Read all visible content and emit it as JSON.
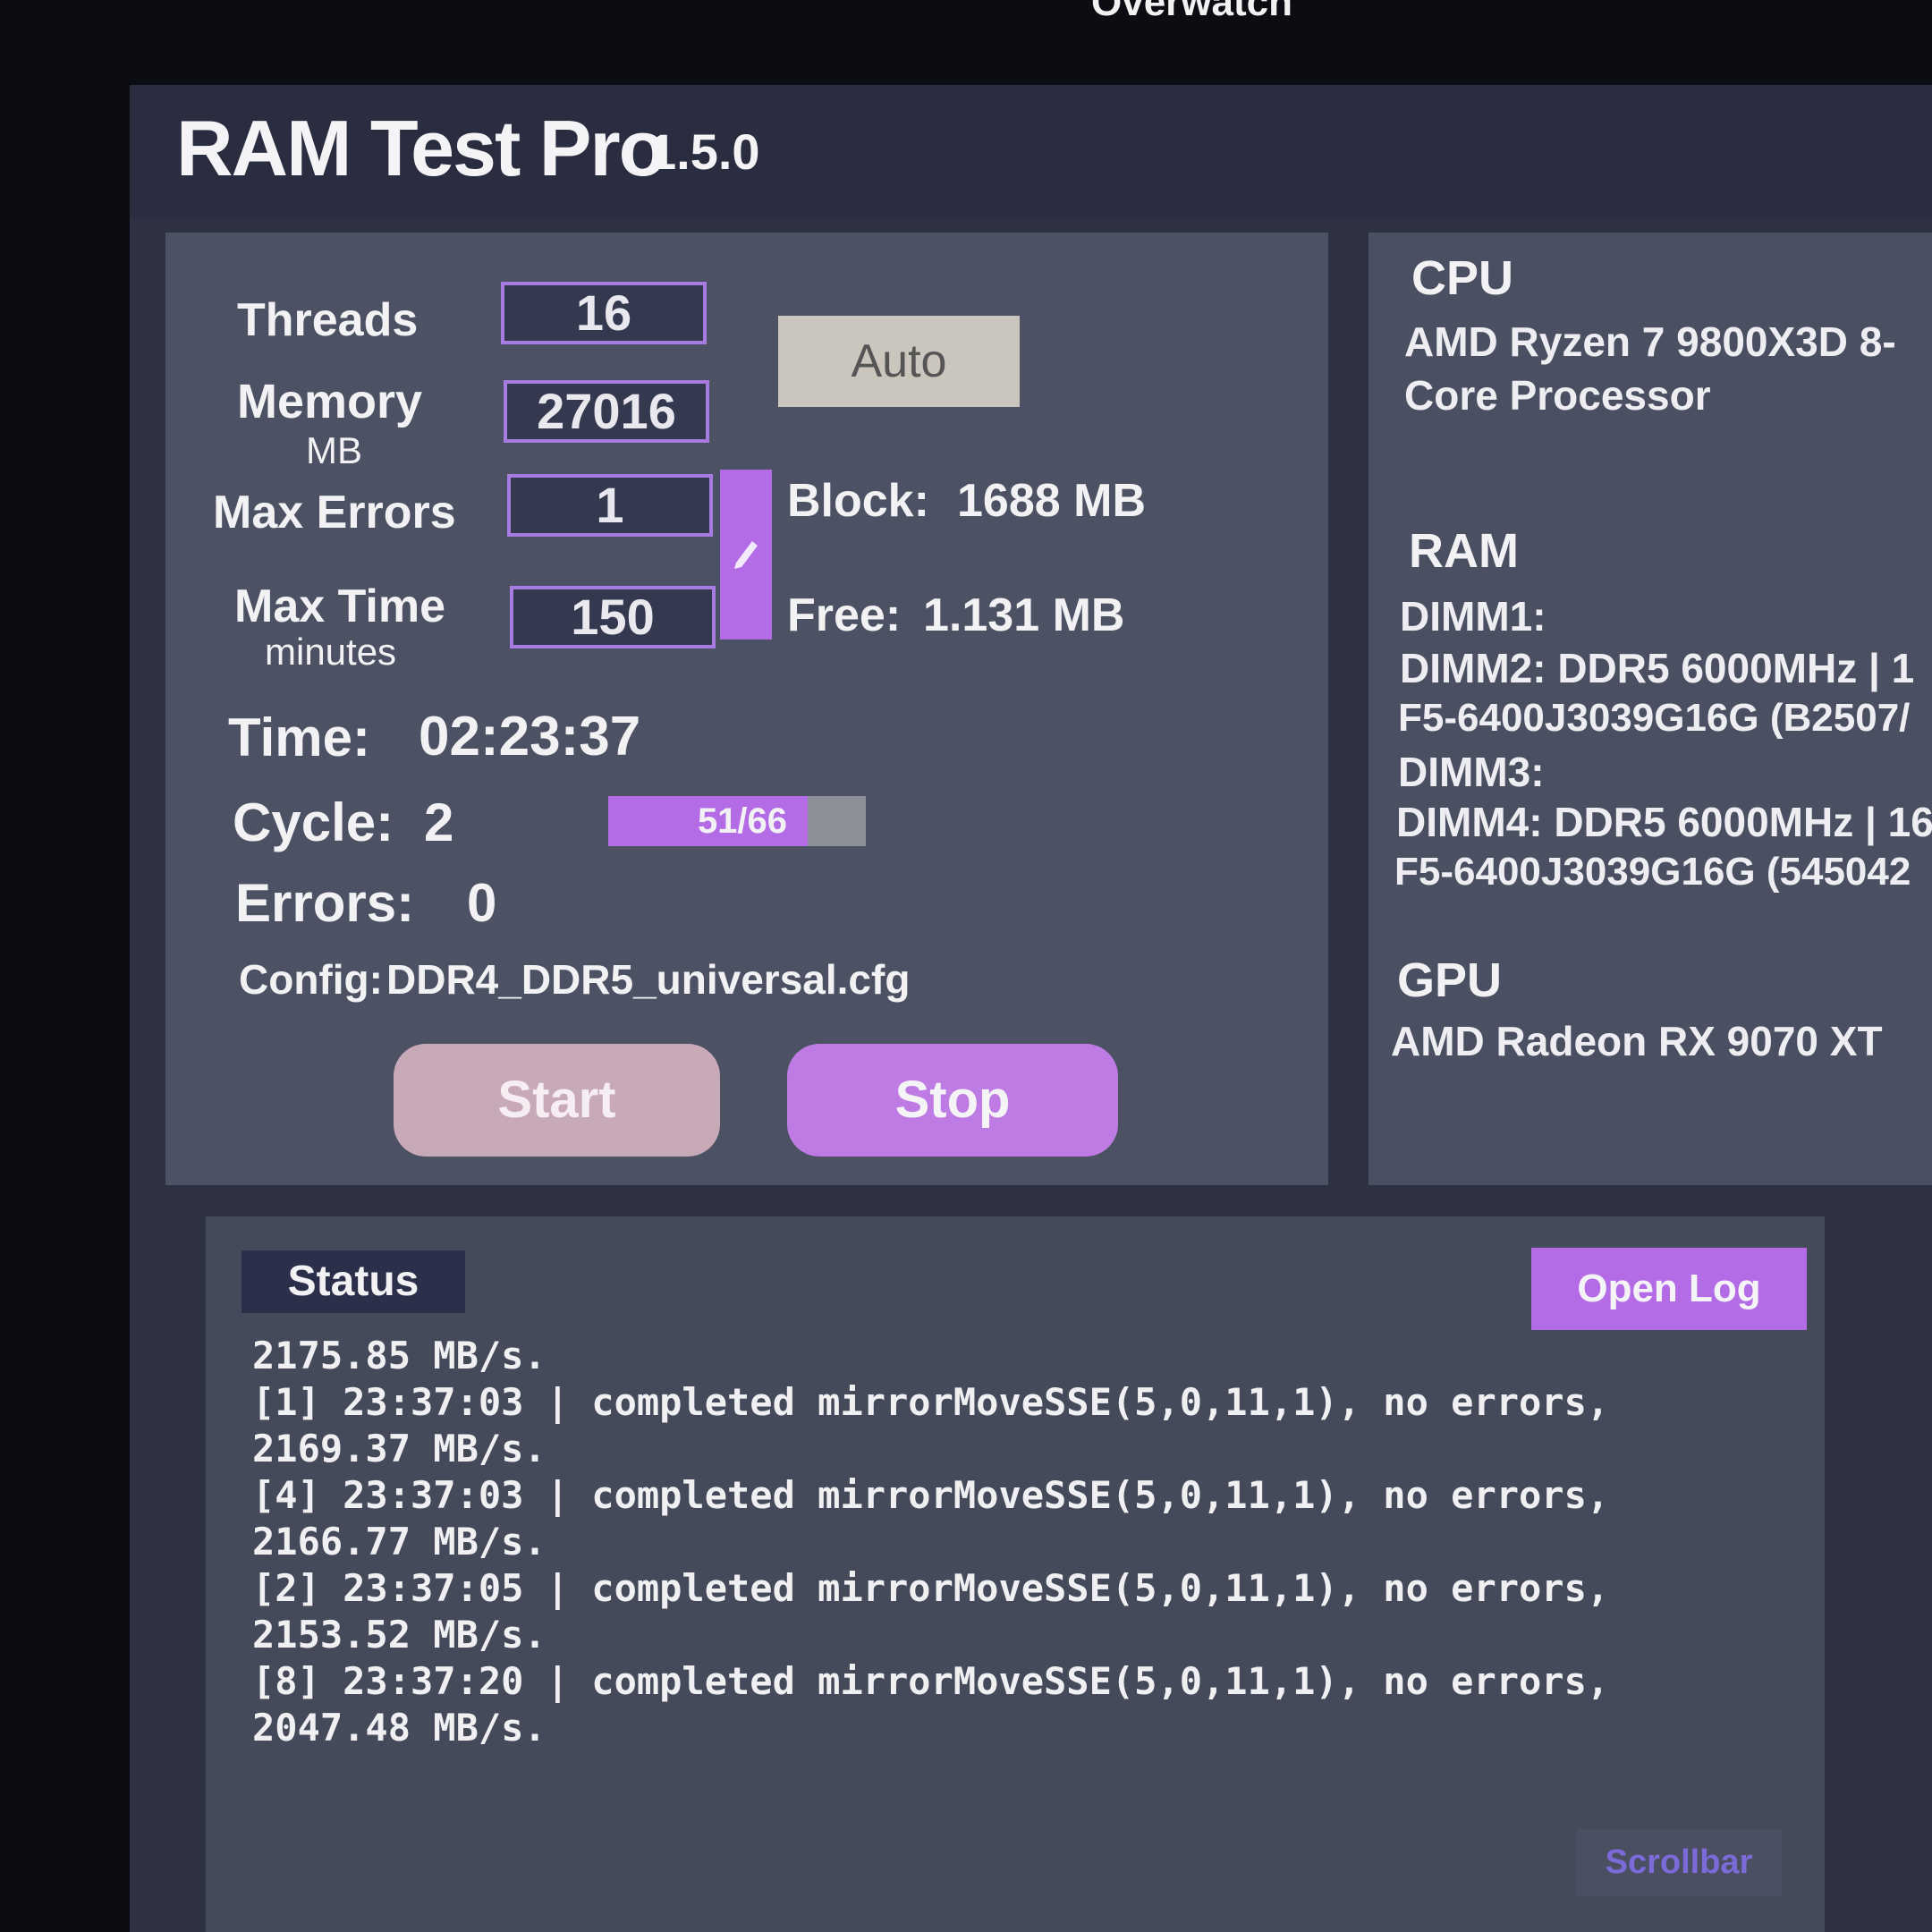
{
  "top_text": "Overwatch",
  "app": {
    "name": "RAM Test Pro",
    "version": "1.5.0"
  },
  "config": {
    "threads_label": "Threads",
    "threads_value": "16",
    "memory_label": "Memory",
    "memory_unit": "MB",
    "memory_value": "27016",
    "max_errors_label": "Max Errors",
    "max_errors_value": "1",
    "max_time_label": "Max Time",
    "max_time_unit": "minutes",
    "max_time_value": "150",
    "auto_label": "Auto",
    "block_label": "Block:",
    "block_value": "1688 MB",
    "free_label": "Free:",
    "free_value": "1.131 MB",
    "time_label": "Time:",
    "time_value": "02:23:37",
    "cycle_label": "Cycle:",
    "cycle_value": "2",
    "progress_text": "51/66",
    "progress_fraction": 0.773,
    "errors_label": "Errors:",
    "errors_value": "0",
    "config_label": "Config:",
    "config_value": "DDR4_DDR5_universal.cfg",
    "start_label": "Start",
    "stop_label": "Stop"
  },
  "info": {
    "cpu_head": "CPU",
    "cpu_line1": "AMD Ryzen 7 9800X3D 8-",
    "cpu_line2": "Core Processor",
    "ram_head": "RAM",
    "ram_lines": [
      "DIMM1:",
      "DIMM2: DDR5 6000MHz | 1",
      "F5-6400J3039G16G (B2507/",
      "DIMM3:",
      "DIMM4: DDR5 6000MHz | 16",
      "F5-6400J3039G16G (545042"
    ],
    "gpu_head": "GPU",
    "gpu_value": "AMD Radeon RX 9070 XT"
  },
  "status": {
    "tab_label": "Status",
    "open_log_label": "Open Log",
    "log_lines": [
      "2175.85 MB/s.",
      "[1] 23:37:03 | completed mirrorMoveSSE(5,0,11,1), no errors,",
      "2169.37 MB/s.",
      "[4] 23:37:03 | completed mirrorMoveSSE(5,0,11,1), no errors,",
      "2166.77 MB/s.",
      "[2] 23:37:05 | completed mirrorMoveSSE(5,0,11,1), no errors,",
      "2153.52 MB/s.",
      "[8] 23:37:20 | completed mirrorMoveSSE(5,0,11,1), no errors,",
      "2047.48 MB/s."
    ],
    "scrollbar_label": "Scrollbar"
  },
  "colors": {
    "accent": "#b46be6",
    "field_bg": "#343950",
    "panel_bg": "#4c5263",
    "title_bg": "#2a2d3f"
  }
}
